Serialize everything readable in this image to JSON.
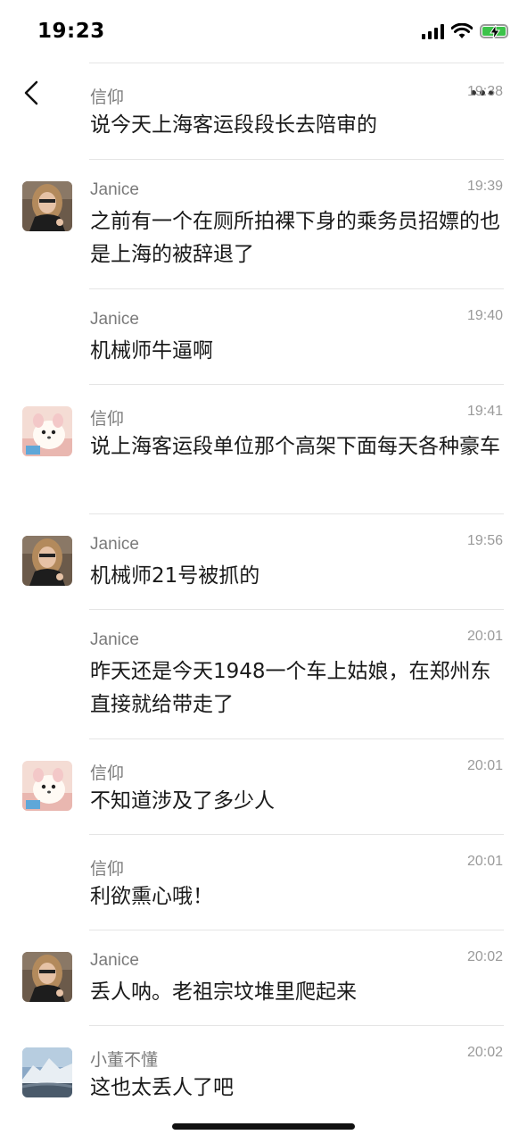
{
  "status_bar": {
    "time": "19:23",
    "icons": [
      "signal-icon",
      "wifi-icon",
      "battery-charging-icon"
    ]
  },
  "nav": {
    "back_icon": "back-chevron-icon",
    "more_icon": "more-icon"
  },
  "messages": [
    {
      "sender": "信仰",
      "time": "19:38",
      "text": "说今天上海客运段段长去陪审的",
      "avatar": ""
    },
    {
      "sender": "Janice",
      "time": "19:39",
      "text": "之前有一个在厕所拍裸下身的乘务员招嫖的也是上海的被辞退了",
      "avatar": "portrait"
    },
    {
      "sender": "Janice",
      "time": "19:40",
      "text": "机械师牛逼啊",
      "avatar": ""
    },
    {
      "sender": "信仰",
      "time": "19:41",
      "text": "说上海客运段单位那个高架下面每天各种豪车",
      "avatar": "puppy"
    },
    {
      "sender": "Janice",
      "time": "19:56",
      "text": "机械师21号被抓的",
      "avatar": "portrait"
    },
    {
      "sender": "Janice",
      "time": "20:01",
      "text": "昨天还是今天1948一个车上姑娘，在郑州东直接就给带走了",
      "avatar": ""
    },
    {
      "sender": "信仰",
      "time": "20:01",
      "text": "不知道涉及了多少人",
      "avatar": "puppy"
    },
    {
      "sender": "信仰",
      "time": "20:01",
      "text": "利欲熏心哦！",
      "avatar": ""
    },
    {
      "sender": "Janice",
      "time": "20:02",
      "text": "丢人呐。老祖宗坟堆里爬起来",
      "avatar": "portrait"
    },
    {
      "sender": "小董不懂",
      "time": "20:02",
      "text": "这也太丢人了吧",
      "avatar": "mountain"
    }
  ],
  "colors": {
    "sender": "#7a7a7a",
    "text": "#1a1a1a",
    "divider": "#e5e5e5",
    "battery": "#3cc34a"
  }
}
